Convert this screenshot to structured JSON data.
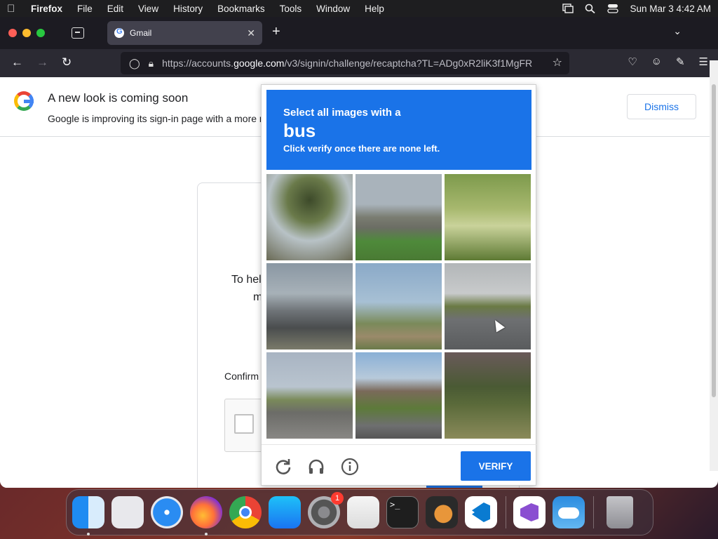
{
  "menubar": {
    "app": "Firefox",
    "items": [
      "File",
      "Edit",
      "View",
      "History",
      "Bookmarks",
      "Tools",
      "Window",
      "Help"
    ],
    "clock": "Sun Mar 3  4:42 AM"
  },
  "browser": {
    "tab_title": "Gmail",
    "url_prefix": "https://accounts.",
    "url_domain": "google.com",
    "url_rest": "/v3/signin/challenge/recaptcha?TL=ADg0xR2liK3f1MgFR"
  },
  "banner": {
    "title": "A new look is coming soon",
    "text": "Google is improving its sign-in page with a more m",
    "dismiss_label": "Dismiss"
  },
  "page": {
    "help_line1": "To hel",
    "help_line2": "m",
    "confirm_label": "Confirm"
  },
  "challenge": {
    "line1": "Select all images with a",
    "target": "bus",
    "line3": "Click verify once there are none left.",
    "verify_label": "VERIFY",
    "tiles": [
      "tile-1",
      "tile-2",
      "tile-3",
      "tile-4",
      "tile-5",
      "tile-6",
      "tile-7",
      "tile-8",
      "tile-9"
    ]
  },
  "dock": {
    "settings_badge": "1",
    "terminal_prompt": ">_"
  },
  "icons": {
    "reload": "reload-icon",
    "audio": "headphones-icon",
    "info": "info-icon"
  }
}
